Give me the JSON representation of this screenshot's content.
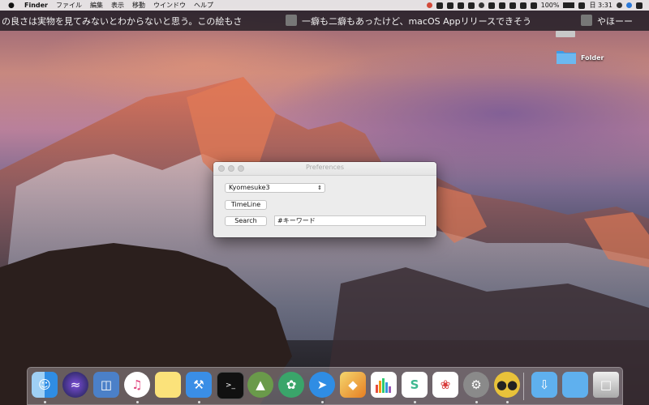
{
  "menubar": {
    "app_name": "Finder",
    "menus": [
      "ファイル",
      "編集",
      "表示",
      "移動",
      "ウインドウ",
      "ヘルプ"
    ],
    "battery": "100%",
    "clock": "日 3:31"
  },
  "ticker": {
    "items": [
      "の良さは実物を見てみないとわからないと思う。この絵もさ",
      "一癖も二癖もあったけど、macOS Appリリースできそう",
      "やほーー"
    ]
  },
  "desktop": {
    "folder_label": "Folder"
  },
  "window": {
    "title": "Preferences",
    "account_select": "Kyomesuke3",
    "timeline_button": "TimeLine",
    "search_button": "Search",
    "search_value": "#キーワード"
  },
  "dock": {
    "apps": [
      "Finder",
      "Siri",
      "Preview",
      "iTunes",
      "Notes",
      "Xcode",
      "Terminal",
      "Android Studio",
      "Atom",
      "Safari",
      "Sketch",
      "Charts",
      "Slack",
      "Scapple",
      "System Preferences",
      "Tweetbot",
      "Downloads",
      "Documents",
      "Trash"
    ]
  }
}
